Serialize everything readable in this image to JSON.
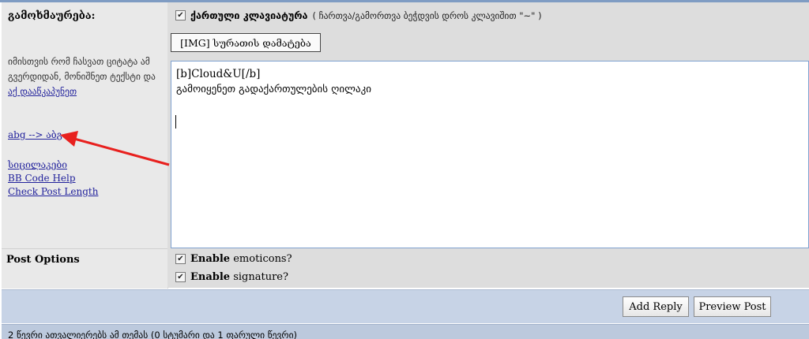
{
  "left_panel": {
    "title": "გამოხმაურება:",
    "hint_text": "იმისთვის რომ ჩასვათ ციტატა ამ გვერდიდან, მონიშნეთ ტექსტი და ",
    "hint_link": "აქ დააწკაპუნეთ",
    "links": {
      "translit": "abg --> აბგ",
      "smilies": "სიცილაკები",
      "bbcode": "BB Code Help",
      "check_length": "Check Post Length"
    }
  },
  "keyboard": {
    "label": "ქართული კლავიატურა",
    "note": "( ჩართვა/გამორთვა ბეჭდვის დროს კლავიშით \"~\" )",
    "checked_symbol": "✔"
  },
  "image_button_label": "[IMG] სურათის დამატება",
  "editor": {
    "line1": "[b]Cloud&U[/b]",
    "line2": "გამოიყენეთ გადაქართულების ღილაკი"
  },
  "post_options": {
    "title": "Post Options",
    "emoticons_bold": "Enable",
    "emoticons_rest": " emoticons?",
    "signature_bold": "Enable",
    "signature_rest": " signature?"
  },
  "buttons": {
    "add_reply": "Add Reply",
    "preview": "Preview Post"
  },
  "status_text": "2 წევრი ათვალიერებს ამ თემას (0 სტუმარი და 1 ფარული წევრი)",
  "colors": {
    "annotation_arrow": "#e8201e",
    "link": "#22229c",
    "footer_bar": "#c7d3e6"
  }
}
